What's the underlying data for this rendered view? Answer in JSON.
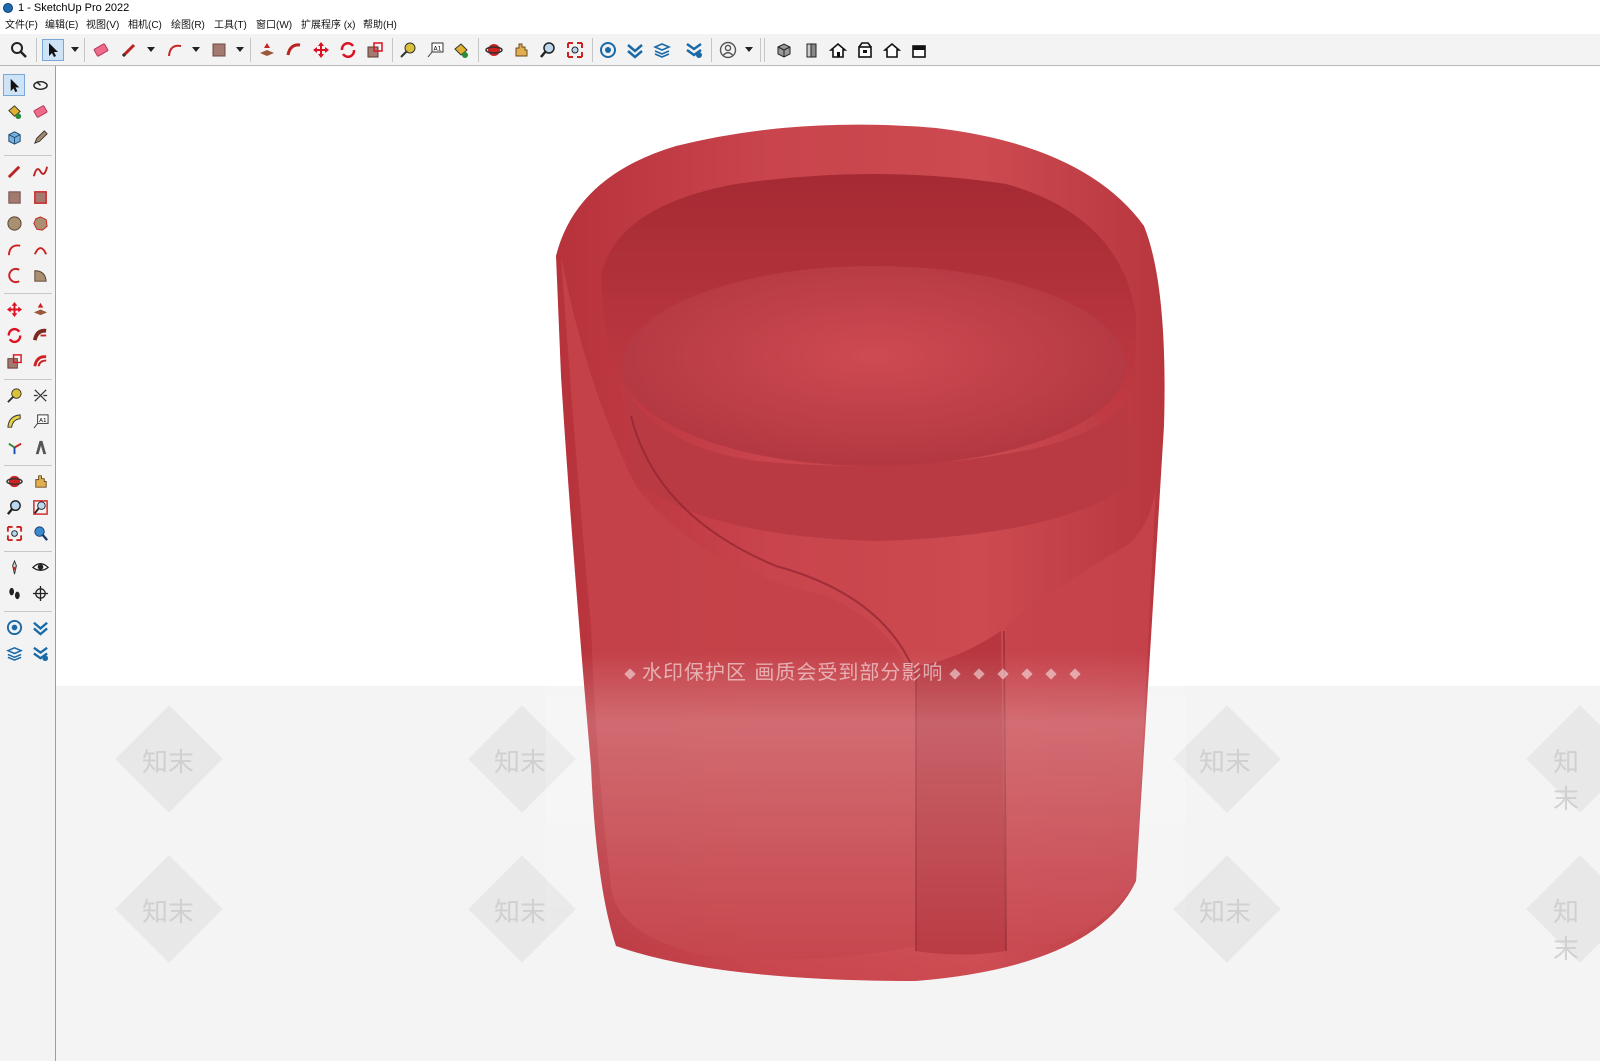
{
  "window": {
    "title": "1 - SketchUp Pro 2022"
  },
  "menu": [
    {
      "label": "文件(F)"
    },
    {
      "label": "编辑(E)"
    },
    {
      "label": "视图(V)"
    },
    {
      "label": "相机(C)"
    },
    {
      "label": "绘图(R)"
    },
    {
      "label": "工具(T)"
    },
    {
      "label": "窗口(W)"
    },
    {
      "label": "扩展程序 (x)"
    },
    {
      "label": "帮助(H)"
    }
  ],
  "toolbar": {
    "icons": [
      "search-icon",
      "select-icon",
      "eraser-icon",
      "pencil-icon",
      "arc-icon",
      "rectangle-icon",
      "push-pull-icon",
      "follow-me-icon",
      "move-icon",
      "rotate-icon",
      "scale-icon",
      "tape-measure-icon",
      "text-icon",
      "paint-bucket-icon",
      "orbit-icon",
      "pan-icon",
      "zoom-icon",
      "zoom-extents-icon",
      "warehouse-icon",
      "extension-warehouse-icon",
      "layout-icon",
      "send-to-layout-icon",
      "user-icon",
      "iso-view-icon",
      "front-view-icon",
      "top-view-icon",
      "right-view-icon",
      "back-view-icon",
      "left-view-icon"
    ]
  },
  "left_toolbar": {
    "icons": [
      "select-icon",
      "orbit-icon",
      "paint-bucket-icon",
      "eraser-icon",
      "component-icon",
      "tag-icon",
      "line-icon",
      "freehand-icon",
      "rectangle-icon",
      "rotated-rectangle-icon",
      "circle-icon",
      "polygon-icon",
      "arc-icon",
      "two-point-arc-icon",
      "three-point-arc-icon",
      "pie-icon",
      "move-icon",
      "push-pull-icon",
      "rotate-icon",
      "follow-me-icon",
      "scale-icon",
      "offset-icon",
      "tape-measure-icon",
      "dimension-icon",
      "protractor-icon",
      "text-icon",
      "axes-icon",
      "3d-text-icon",
      "orbit-icon",
      "pan-icon",
      "zoom-icon",
      "zoom-window-icon",
      "zoom-extents-icon",
      "position-camera-icon",
      "walk-icon",
      "look-around-icon",
      "footprints-icon",
      "section-plane-icon",
      "warehouse-icon",
      "extension-icon",
      "layers-icon",
      "share-icon"
    ]
  },
  "viewport": {
    "watermark_banner": "水印保护区  画质会受到部分影响",
    "watermark_text": "知末"
  },
  "colors": {
    "chair": "#c94048",
    "chair_dark": "#a42d36",
    "toolbar_bg": "#f3f3f3",
    "accent": "#cfe3f7"
  }
}
